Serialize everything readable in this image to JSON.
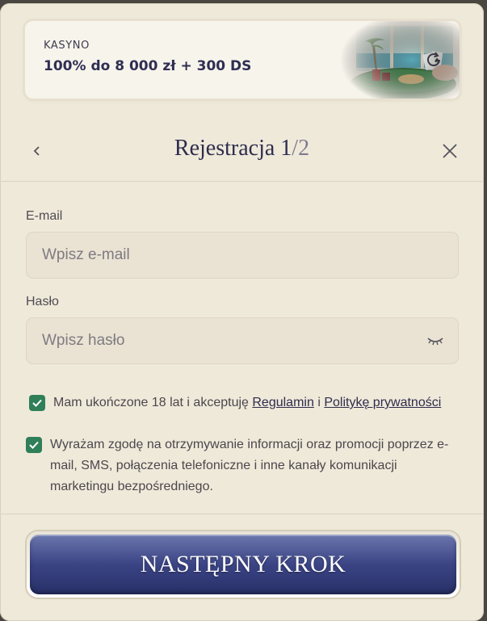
{
  "banner": {
    "tag": "KASYNO",
    "offer": "100% do 8 000 zł + 300 DS"
  },
  "header": {
    "title": "Rejestracja 1",
    "step_suffix": "/2"
  },
  "form": {
    "email_label": "E-mail",
    "email_placeholder": "Wpisz e-mail",
    "password_label": "Hasło",
    "password_placeholder": "Wpisz hasło"
  },
  "consents": {
    "age_text": "Mam ukończone 18 lat i akceptuję",
    "terms_link": "Regulamin",
    "and": "i",
    "privacy_link": "Politykę prywatności",
    "marketing_line1": "Wyrażam zgodę na otrzymywanie informacji oraz promocji poprzez e-",
    "marketing_line2": "mail, SMS, połączenia telefoniczne i inne kanały komunikacji",
    "marketing_line3": "marketingu bezpośredniego.",
    "age_checked": true,
    "marketing_checked": true
  },
  "cta": {
    "label": "NASTĘPNY KROK"
  },
  "colors": {
    "accent": "#3b4484",
    "checkbox": "#2f7f58",
    "background": "#efe9da"
  }
}
